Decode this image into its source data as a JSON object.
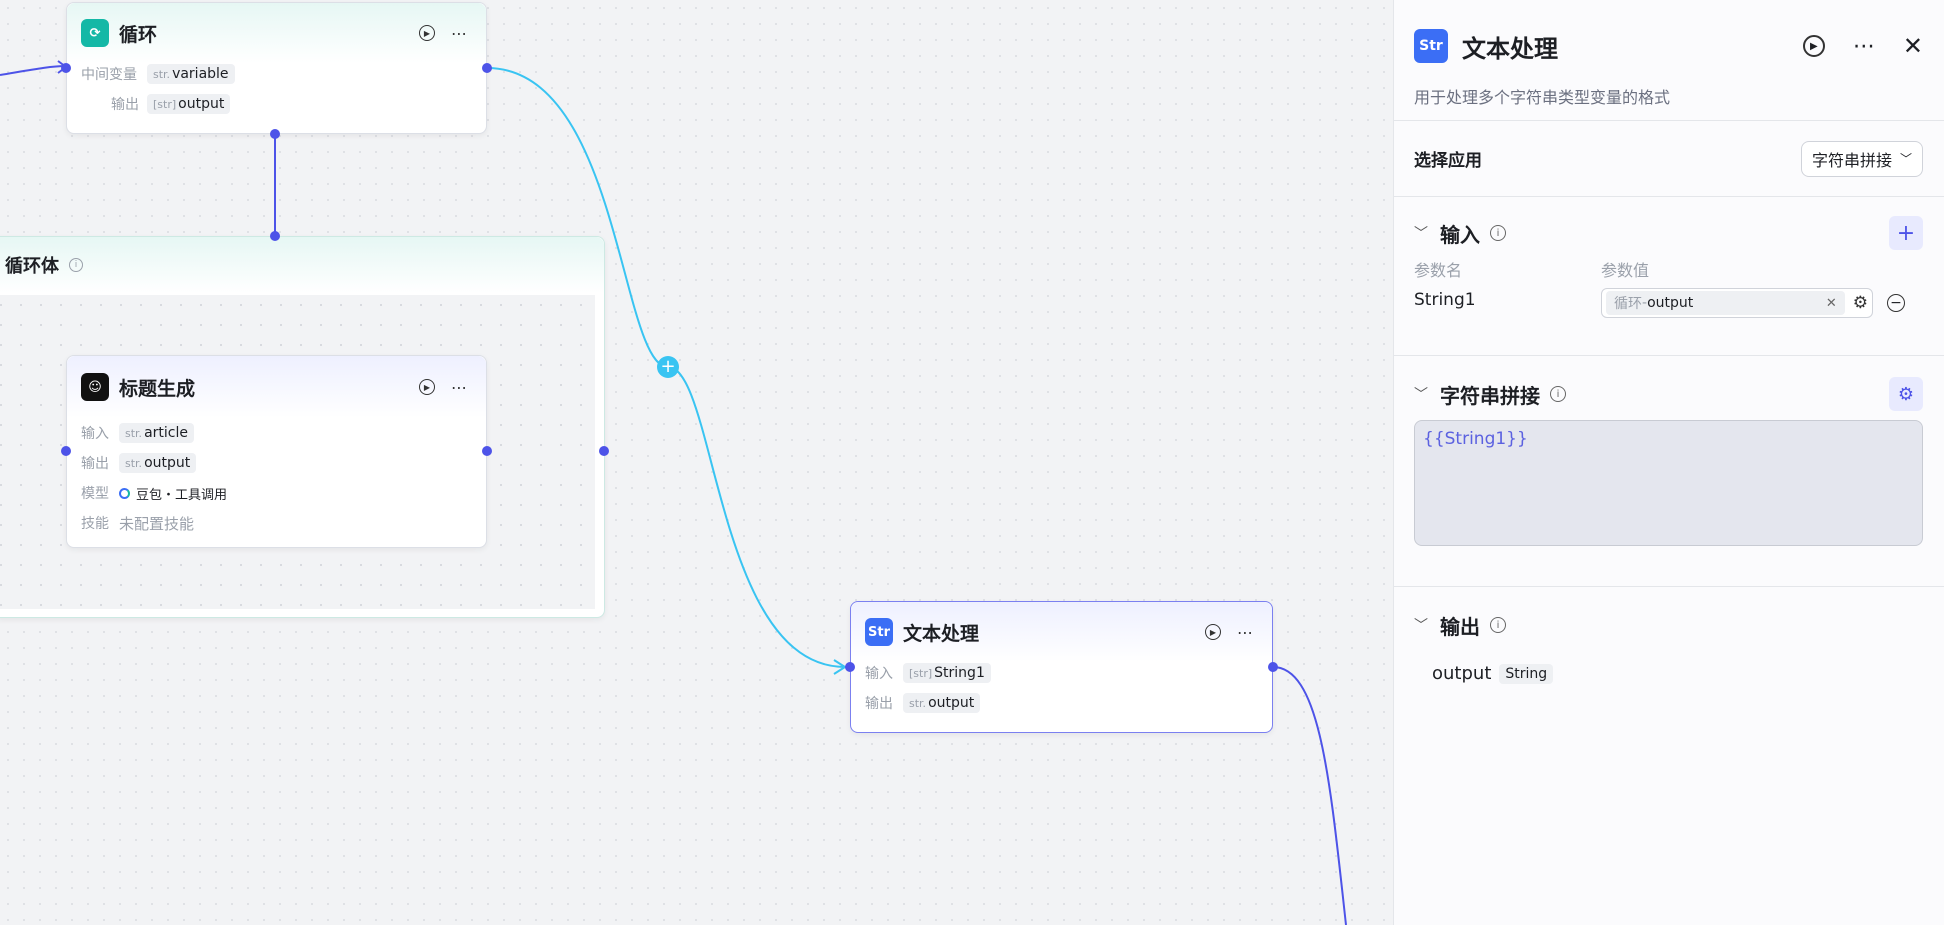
{
  "canvas": {
    "loop_node": {
      "title": "循环",
      "rows": [
        {
          "label": "中间变量",
          "type": "str.",
          "value": "variable"
        },
        {
          "label": "输出",
          "type": "[str]",
          "value": "output"
        }
      ]
    },
    "loop_body": {
      "title": "循环体"
    },
    "title_gen_node": {
      "title": "标题生成",
      "rows": [
        {
          "label": "输入",
          "type": "str.",
          "value": "article"
        },
        {
          "label": "输出",
          "type": "str.",
          "value": "output"
        }
      ],
      "model_label": "模型",
      "model_value": "豆包・工具调用",
      "skill_label": "技能",
      "skill_value": "未配置技能"
    },
    "text_node": {
      "title": "文本处理",
      "rows": [
        {
          "label": "输入",
          "type": "[str]",
          "value": "String1"
        },
        {
          "label": "输出",
          "type": "str.",
          "value": "output"
        }
      ]
    }
  },
  "panel": {
    "title": "文本处理",
    "description": "用于处理多个字符串类型变量的格式",
    "select_app_label": "选择应用",
    "select_app_value": "字符串拼接",
    "input_section": {
      "title": "输入",
      "col_name": "参数名",
      "col_value": "参数值",
      "param_name": "String1",
      "param_ref_node": "循环",
      "param_ref_sep": " - ",
      "param_ref_var": "output"
    },
    "concat_section": {
      "title": "字符串拼接",
      "template": "{{String1}}"
    },
    "output_section": {
      "title": "输出",
      "var_name": "output",
      "var_type": "String"
    }
  },
  "colors": {
    "accent": "#4d53e8",
    "edge_cyan": "#39c4f2",
    "teal": "#14b8a6",
    "blue_icon": "#3b6ef5"
  },
  "icons": {
    "loop": "loop-icon",
    "llm": "llm-icon",
    "text": "str-icon",
    "play": "play-circle-icon",
    "more": "more-icon",
    "close": "close-icon",
    "gear": "gear-icon",
    "minus": "minus-circle-icon",
    "plus": "plus-icon"
  }
}
